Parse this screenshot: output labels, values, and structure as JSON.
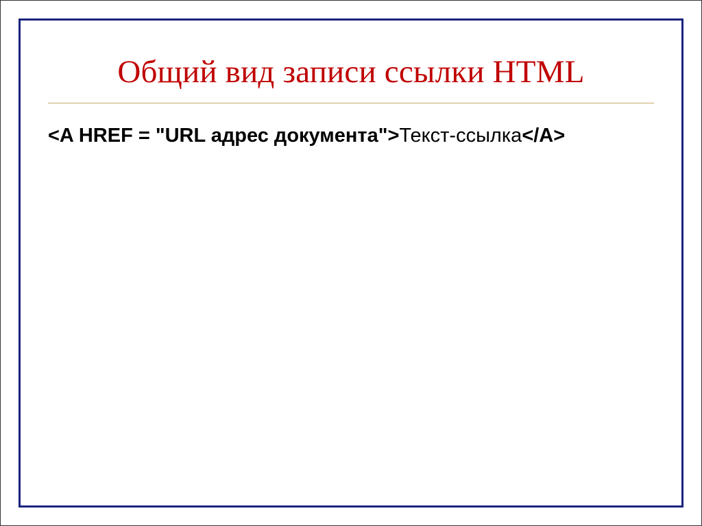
{
  "slide": {
    "title": "Общий вид записи ссылки HTML",
    "code_bold": "<A HREF = \"URL адрес документа\">",
    "code_rest": "Текст-ссылка",
    "code_close_bold": "</A>"
  }
}
